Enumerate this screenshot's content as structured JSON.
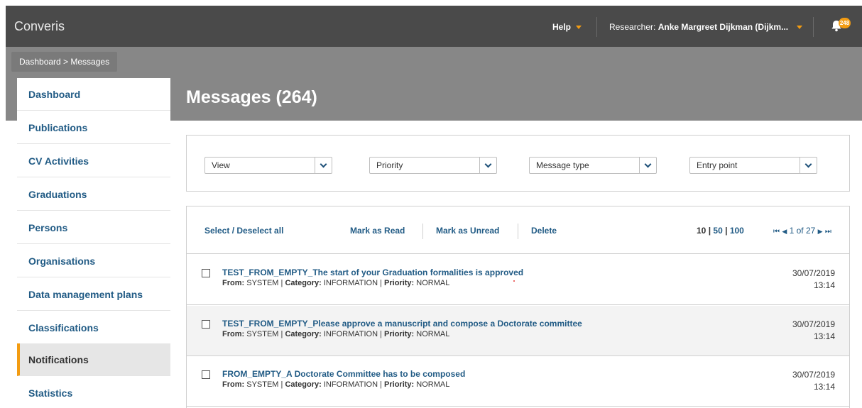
{
  "header": {
    "app_name": "Converis",
    "help_label": "Help",
    "researcher_prefix": "Researcher:",
    "researcher_name": "Anke Margreet Dijkman (Dijkm...",
    "notification_count": "248"
  },
  "breadcrumb": "Dashboard > Messages",
  "page_title": "Messages (264)",
  "sidebar": {
    "items": [
      {
        "label": "Dashboard"
      },
      {
        "label": "Publications"
      },
      {
        "label": "CV Activities"
      },
      {
        "label": "Graduations"
      },
      {
        "label": "Persons"
      },
      {
        "label": "Organisations"
      },
      {
        "label": "Data management plans"
      },
      {
        "label": "Classifications"
      },
      {
        "label": "Notifications",
        "active": true
      },
      {
        "label": "Statistics"
      }
    ]
  },
  "filters": {
    "view": "View",
    "priority": "Priority",
    "message_type": "Message type",
    "entry_point": "Entry point"
  },
  "actions": {
    "select_all": "Select / Deselect all",
    "mark_read": "Mark as Read",
    "mark_unread": "Mark as Unread",
    "delete": "Delete"
  },
  "pagination": {
    "size_10": "10",
    "sep": "|",
    "size_50": "50",
    "size_100": "100",
    "first": "⏮",
    "prev": "◀",
    "info": "1 of 27",
    "next": "▶",
    "last": "⏭"
  },
  "meta_labels": {
    "from": "From:",
    "category": "Category:",
    "priority": "Priority:",
    "sep": "|"
  },
  "messages": [
    {
      "title": "TEST_FROM_EMPTY_The start of your Graduation formalities is approved",
      "from": "SYSTEM",
      "category": "INFORMATION",
      "priority": "NORMAL",
      "date": "30/07/2019",
      "time": "13:14"
    },
    {
      "title": "TEST_FROM_EMPTY_Please approve a manuscript and compose a Doctorate committee",
      "from": "SYSTEM",
      "category": "INFORMATION",
      "priority": "NORMAL",
      "date": "30/07/2019",
      "time": "13:14"
    },
    {
      "title": "FROM_EMPTY_A Doctorate Committee has to be composed",
      "from": "SYSTEM",
      "category": "INFORMATION",
      "priority": "NORMAL",
      "date": "30/07/2019",
      "time": "13:14"
    }
  ],
  "colors": {
    "topbar": "#4a4a4a",
    "band": "#878787",
    "link": "#215b85",
    "accent": "#f39c12"
  },
  "icons": {
    "bell": "bell-icon",
    "chevron": "chevron-down-icon",
    "caret": "caret-down-icon"
  }
}
